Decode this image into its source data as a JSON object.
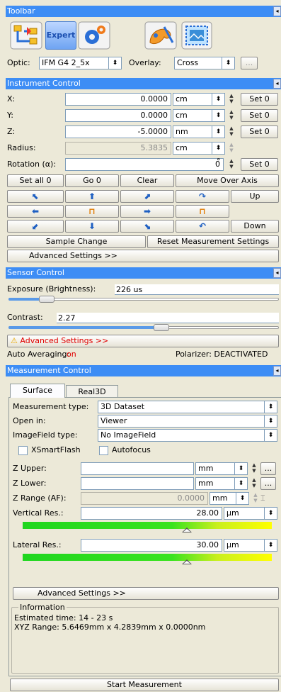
{
  "toolbar": {
    "title": "Toolbar",
    "expert_label": "Expert",
    "optic_label": "Optic:",
    "optic_value": "IFM G4 2_5x",
    "overlay_label": "Overlay:",
    "overlay_value": "Cross",
    "more_label": "..."
  },
  "instrument": {
    "title": "Instrument Control",
    "rows": [
      {
        "label": "X:",
        "value": "0.0000",
        "unit": "cm",
        "set": "Set 0"
      },
      {
        "label": "Y:",
        "value": "0.0000",
        "unit": "cm",
        "set": "Set 0"
      },
      {
        "label": "Z:",
        "value": "-5.0000",
        "unit": "nm",
        "set": "Set 0"
      },
      {
        "label": "Radius:",
        "value": "5.3835",
        "unit": "cm"
      },
      {
        "label": "Rotation (α):",
        "value": "0",
        "unit": "°",
        "set": "Set 0"
      }
    ],
    "set_all": "Set all 0",
    "go0": "Go 0",
    "clear": "Clear",
    "move_over_axis": "Move Over Axis",
    "up": "Up",
    "down": "Down",
    "sample_change": "Sample Change",
    "reset_settings": "Reset Measurement Settings",
    "advanced": "Advanced Settings >>"
  },
  "sensor": {
    "title": "Sensor Control",
    "exposure_label": "Exposure (Brightness):",
    "exposure_value": "226 us",
    "exposure_level": 0.12,
    "contrast_label": "Contrast:",
    "contrast_value": "2.27",
    "contrast_level": 0.57,
    "advanced": "Advanced Settings >>",
    "auto_avg_label": "Auto Averaging:",
    "auto_avg_value": "on",
    "polarizer": "Polarizer: DEACTIVATED"
  },
  "measurement": {
    "title": "Measurement Control",
    "tabs": [
      "Surface",
      "Real3D"
    ],
    "type_label": "Measurement type:",
    "type_value": "3D Dataset",
    "open_label": "Open in:",
    "open_value": "Viewer",
    "imagefield_label": "ImageField type:",
    "imagefield_value": "No ImageField",
    "xsmartflash": "XSmartFlash",
    "autofocus": "Autofocus",
    "z_upper_label": "Z Upper:",
    "z_upper_unit": "mm",
    "z_lower_label": "Z Lower:",
    "z_lower_unit": "mm",
    "z_range_label": "Z Range (AF):",
    "z_range_value": "0.0000",
    "z_range_unit": "mm",
    "vres_label": "Vertical Res.:",
    "vres_value": "28.00",
    "vres_unit": "µm",
    "vres_level": 0.66,
    "lres_label": "Lateral Res.:",
    "lres_value": "30.00",
    "lres_unit": "µm",
    "lres_level": 0.66,
    "advanced": "Advanced Settings >>",
    "info_title": "Information",
    "est_time": "Estimated time:  14 - 23 s",
    "xyz_range": "XYZ Range: 5.6469mm x 4.2839mm x 0.0000nm",
    "start": "Start Measurement"
  },
  "colors": {
    "header": "#3d8df5",
    "warning_red": "#e00000"
  }
}
